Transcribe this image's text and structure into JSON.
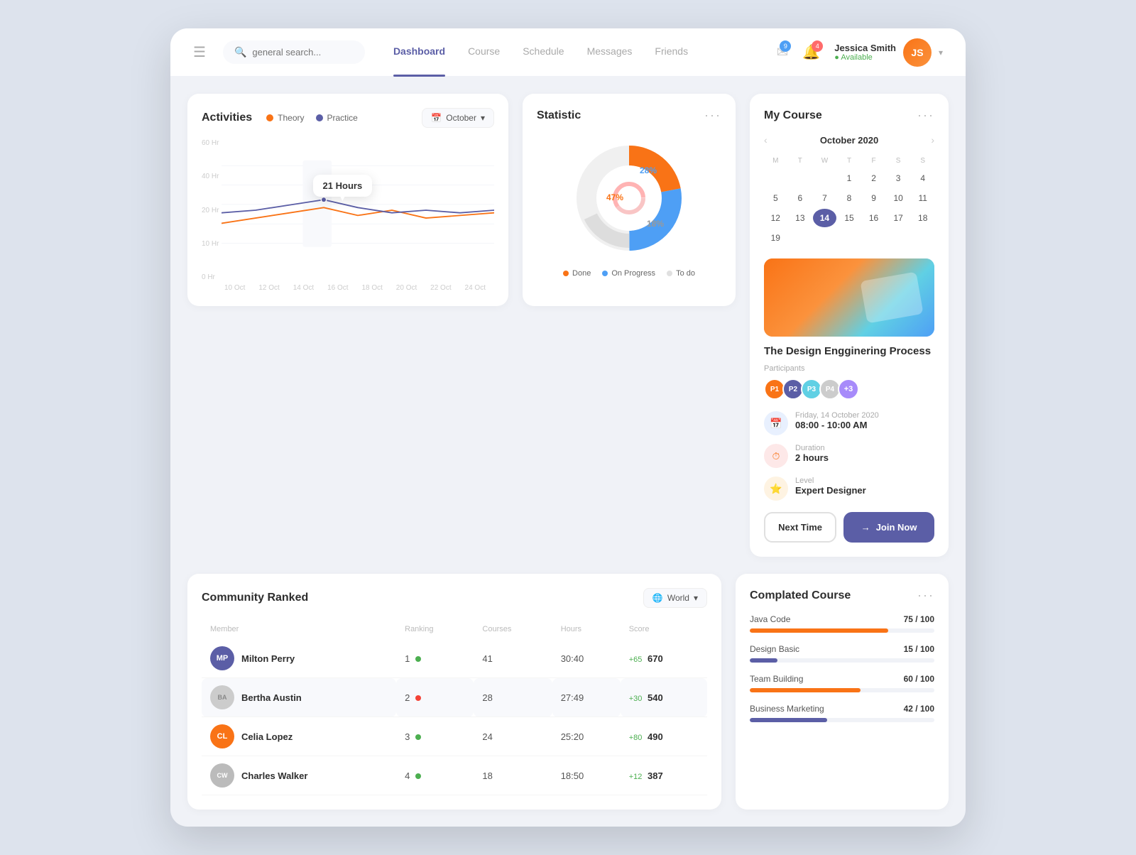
{
  "header": {
    "menu_icon": "☰",
    "search_placeholder": "general search...",
    "nav_items": [
      {
        "label": "Dashboard",
        "active": true
      },
      {
        "label": "Course",
        "active": false
      },
      {
        "label": "Schedule",
        "active": false
      },
      {
        "label": "Messages",
        "active": false
      },
      {
        "label": "Friends",
        "active": false
      }
    ],
    "notifications": [
      {
        "icon": "✉",
        "badge": "9",
        "badge_color": "blue"
      },
      {
        "icon": "🔔",
        "badge": "4",
        "badge_color": "red"
      }
    ],
    "user": {
      "name": "Jessica Smith",
      "status": "Available"
    }
  },
  "activities": {
    "title": "Activities",
    "legend": [
      {
        "label": "Theory",
        "color": "#f97316"
      },
      {
        "label": "Practice",
        "color": "#5b5ea6"
      }
    ],
    "month": "October",
    "tooltip": "21 Hours",
    "y_labels": [
      "60 Hr",
      "40 Hr",
      "20 Hr",
      "10 Hr",
      "0 Hr"
    ],
    "x_labels": [
      "10 Oct",
      "12 Oct",
      "14 Oct",
      "16 Oct",
      "18 Oct",
      "20 Oct",
      "22 Oct",
      "24 Oct"
    ]
  },
  "statistic": {
    "title": "Statistic",
    "segments": [
      {
        "label": "Done",
        "color": "#f97316",
        "percent": 47
      },
      {
        "label": "On Progress",
        "color": "#4e9ff5",
        "percent": 28
      },
      {
        "label": "To do",
        "color": "#e0e0e0",
        "percent": 18
      }
    ]
  },
  "my_course": {
    "title": "My Course",
    "calendar": {
      "month_year": "October 2020",
      "day_headers": [
        "M",
        "T",
        "W",
        "T",
        "F",
        "S",
        "S"
      ],
      "days": [
        {
          "day": "",
          "empty": true
        },
        {
          "day": "",
          "empty": true
        },
        {
          "day": "",
          "empty": true
        },
        {
          "day": "1",
          "empty": false
        },
        {
          "day": "2",
          "empty": false
        },
        {
          "day": "3",
          "empty": false
        },
        {
          "day": "4",
          "empty": false
        },
        {
          "day": "5",
          "empty": false
        },
        {
          "day": "6",
          "empty": false
        },
        {
          "day": "7",
          "empty": false
        },
        {
          "day": "8",
          "empty": false
        },
        {
          "day": "9",
          "empty": false
        },
        {
          "day": "10",
          "empty": false
        },
        {
          "day": "11",
          "empty": false
        },
        {
          "day": "12",
          "empty": false
        },
        {
          "day": "13",
          "empty": false
        },
        {
          "day": "14",
          "empty": false,
          "today": true
        },
        {
          "day": "15",
          "empty": false
        },
        {
          "day": "16",
          "empty": false
        },
        {
          "day": "17",
          "empty": false
        },
        {
          "day": "18",
          "empty": false
        },
        {
          "day": "19",
          "empty": false
        }
      ],
      "week_days_short": [
        {
          "label": "M"
        },
        {
          "label": "T"
        },
        {
          "label": "W"
        },
        {
          "label": "T"
        },
        {
          "label": "F"
        },
        {
          "label": "S"
        },
        {
          "label": "S"
        }
      ],
      "cal_row1": [
        "",
        "",
        "",
        "1",
        "2",
        "3",
        "4"
      ],
      "cal_row2": [
        "5",
        "6",
        "7",
        "8",
        "9",
        "10",
        "11"
      ],
      "cal_row3": [
        "12",
        "13",
        "14",
        "15",
        "16",
        "17",
        "18"
      ],
      "cal_row4": [
        "19"
      ]
    },
    "course_title": "The Design Engginering Process",
    "participants_label": "Participants",
    "participants_extra": "+3",
    "meta": [
      {
        "icon": "📅",
        "icon_class": "blue",
        "label": "Friday, 14 October 2020",
        "value": "08:00 - 10:00 AM"
      },
      {
        "icon": "⏱",
        "icon_class": "pink",
        "label": "Duration",
        "value": "2 hours"
      },
      {
        "icon": "⭐",
        "icon_class": "yellow",
        "label": "Level",
        "value": "Expert Designer"
      }
    ],
    "btn_next_time": "Next Time",
    "btn_join_now": "Join Now"
  },
  "community": {
    "title": "Community Ranked",
    "filter": "World",
    "columns": [
      "Member",
      "Ranking",
      "Courses",
      "Hours",
      "Score"
    ],
    "rows": [
      {
        "name": "Milton Perry",
        "initials": "MP",
        "color": "#5b5ea6",
        "rank": 1,
        "rank_dot": "green",
        "courses": 41,
        "hours": "30:40",
        "delta": "+65",
        "delta_pos": true,
        "score": 670
      },
      {
        "name": "Bertha Austin",
        "initials": "BA",
        "color": "#e8e8e8",
        "img": true,
        "rank": 2,
        "rank_dot": "red",
        "courses": 28,
        "hours": "27:49",
        "delta": "+30",
        "delta_pos": true,
        "score": 540
      },
      {
        "name": "Celia Lopez",
        "initials": "CL",
        "color": "#f97316",
        "rank": 3,
        "rank_dot": "green",
        "courses": 24,
        "hours": "25:20",
        "delta": "+80",
        "delta_pos": true,
        "score": 490
      },
      {
        "name": "Charles Walker",
        "initials": "CW",
        "color": "#e8e8e8",
        "img": true,
        "rank": 4,
        "rank_dot": "green",
        "courses": 18,
        "hours": "18:50",
        "delta": "+12",
        "delta_pos": true,
        "score": 387
      }
    ]
  },
  "completed_course": {
    "title": "Complated Course",
    "items": [
      {
        "name": "Java Code",
        "score": "75 / 100",
        "percent": 75,
        "color": "#f97316"
      },
      {
        "name": "Design Basic",
        "score": "15 / 100",
        "percent": 15,
        "color": "#5b5ea6"
      },
      {
        "name": "Team Building",
        "score": "60 / 100",
        "percent": 60,
        "color": "#f97316"
      },
      {
        "name": "Business Marketing",
        "score": "42 / 100",
        "percent": 42,
        "color": "#5b5ea6"
      }
    ]
  }
}
